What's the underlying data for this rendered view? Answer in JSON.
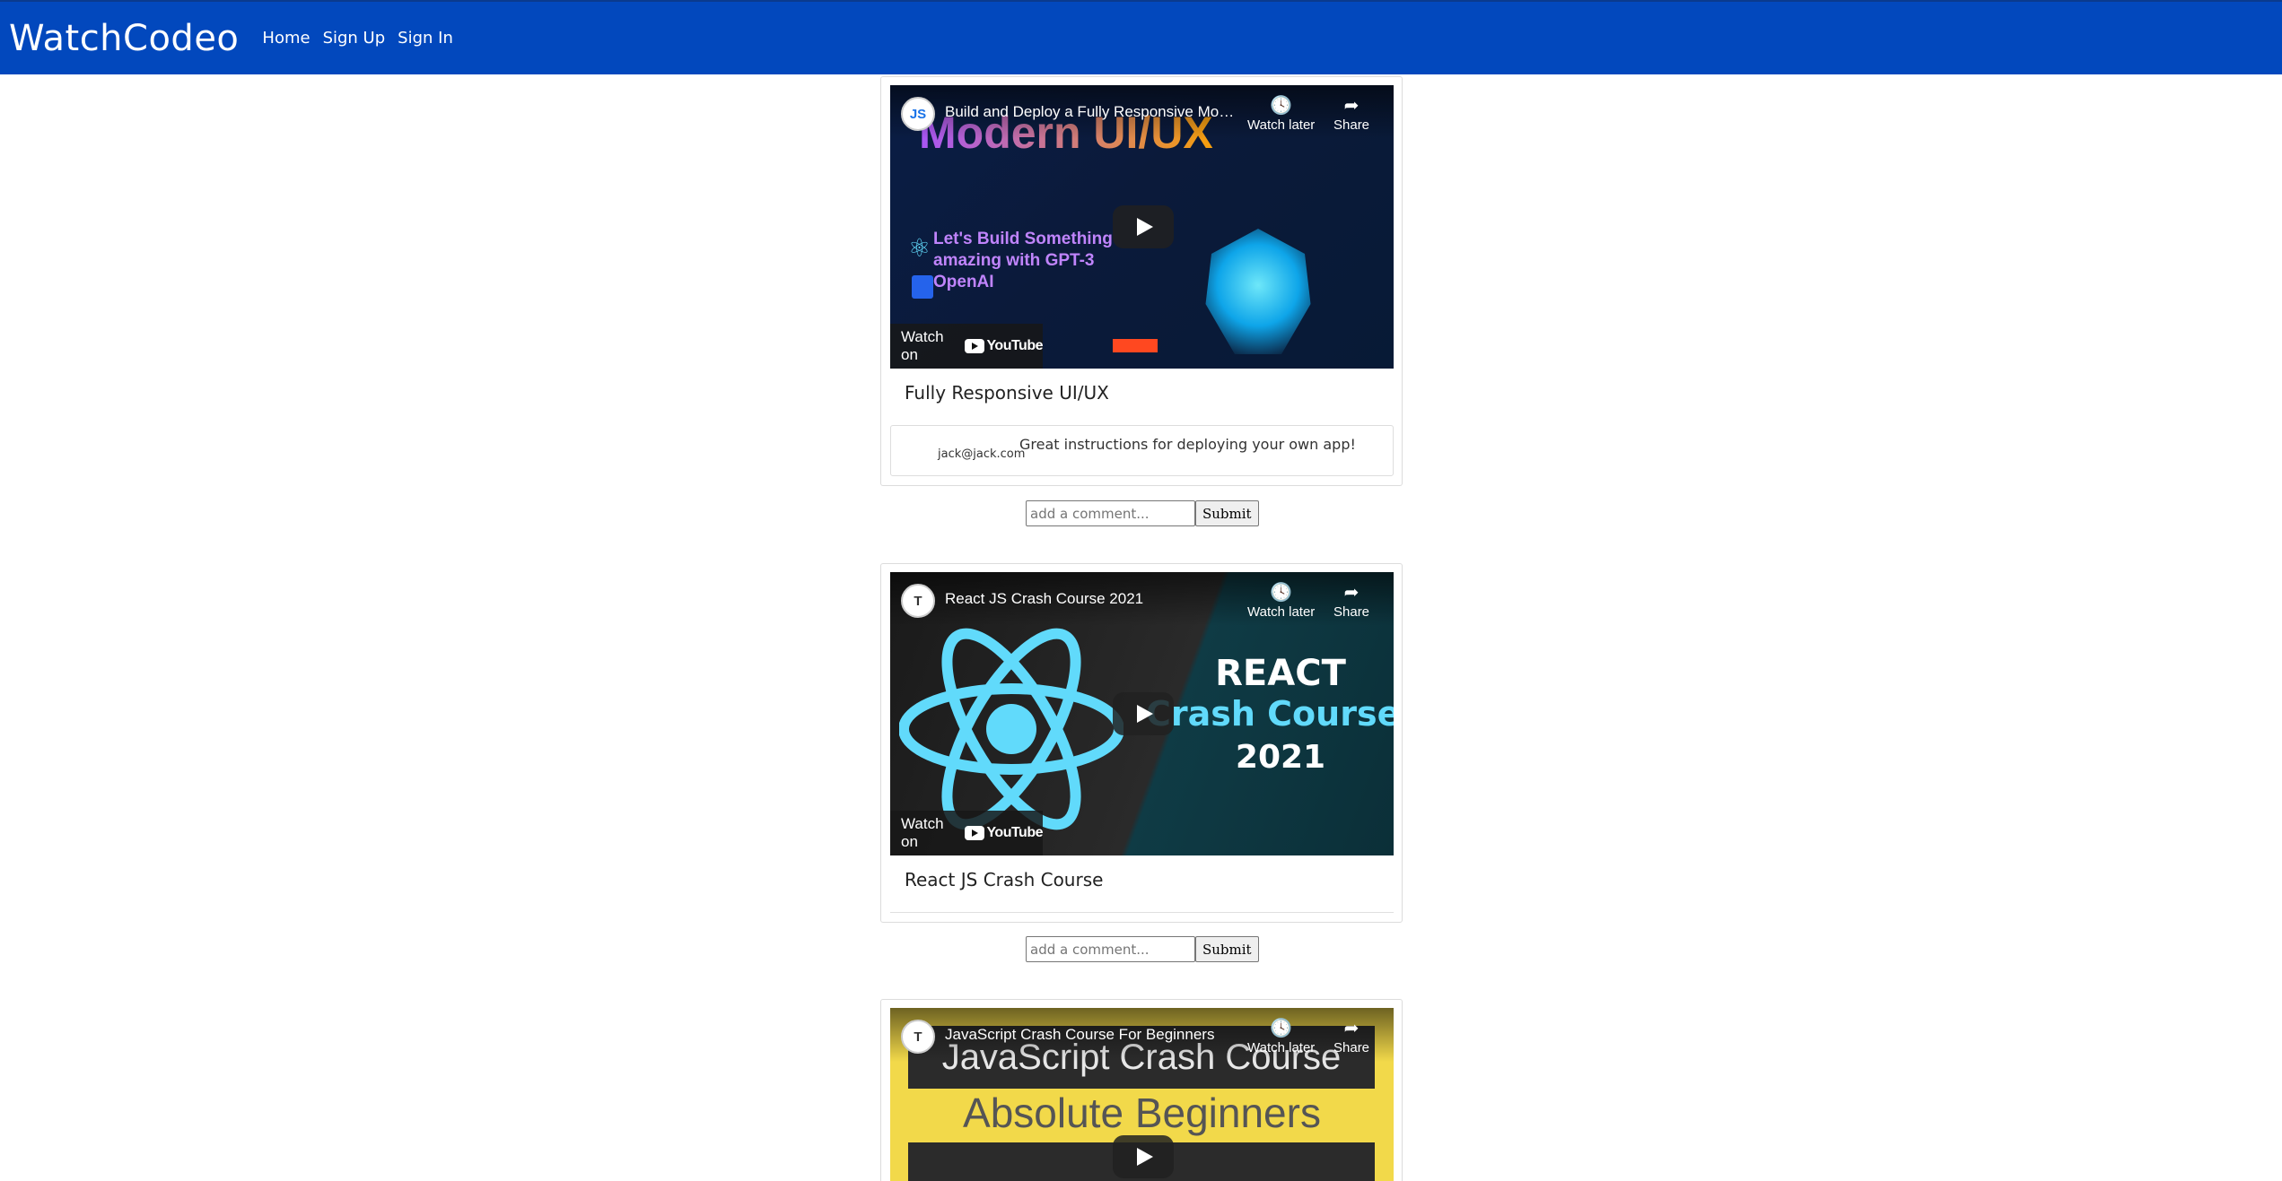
{
  "navbar": {
    "brand": "WatchCodeo",
    "links": [
      "Home",
      "Sign Up",
      "Sign In"
    ]
  },
  "youtube": {
    "watch_later": "Watch later",
    "share": "Share",
    "watch_on": "Watch on",
    "youtube_logo": "YouTube"
  },
  "videos": [
    {
      "embed_title": "Build and Deploy a Fully Responsive Modern UI/UX Website",
      "card_title": "Fully Responsive UI/UX",
      "thumb_heading": "Modern UI/UX",
      "thumb_sub": "Let's Build Something amazing with GPT-3 OpenAI",
      "channel_initials": "JS",
      "comments": [
        {
          "email": "jack@jack.com",
          "text": "Great instructions for deploying your own app!"
        }
      ]
    },
    {
      "embed_title": "React JS Crash Course 2021",
      "card_title": "React JS Crash Course",
      "thumb_line1": "REACT",
      "thumb_line2": "Crash Course",
      "thumb_line3": "2021",
      "channel_initials": "T",
      "comments": []
    },
    {
      "embed_title": "JavaScript Crash Course For Beginners",
      "thumb_line1": "JavaScript Crash Course",
      "thumb_line2": "Absolute Beginners",
      "channel_initials": "T"
    }
  ],
  "comment_form": {
    "placeholder": "add a comment...",
    "submit_label": "Submit"
  },
  "icons": {
    "clock": "clock-icon",
    "share": "share-icon",
    "play": "play-icon"
  }
}
